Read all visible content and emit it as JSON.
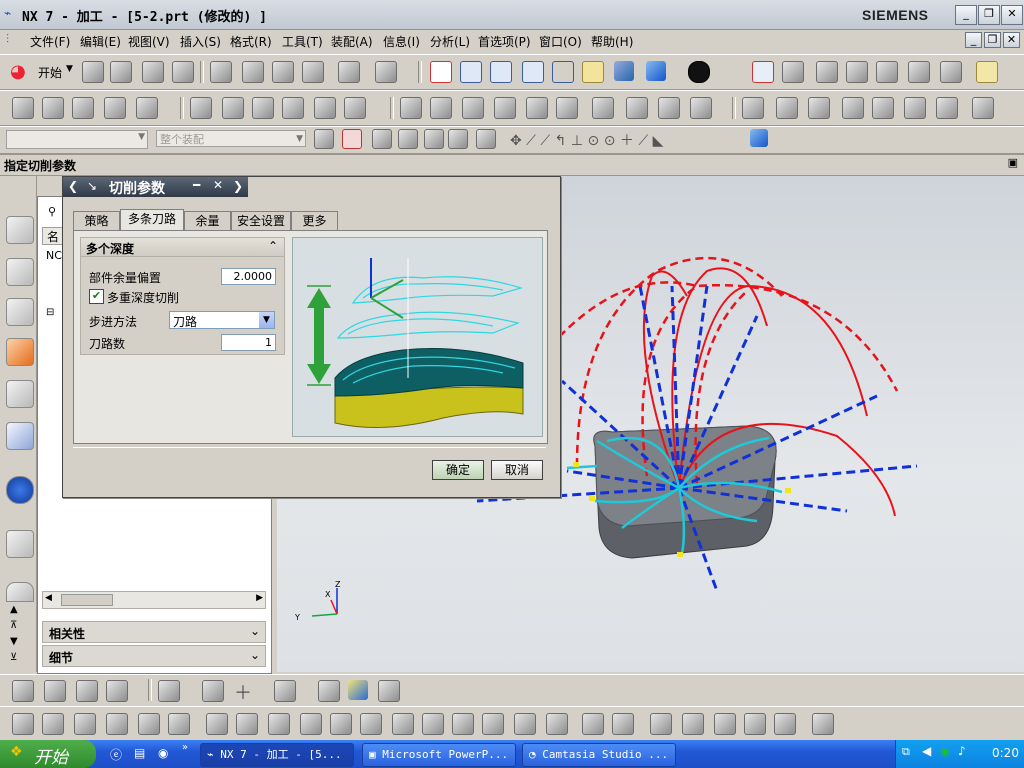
{
  "titlebar": {
    "title": "NX 7 - 加工 - [5-2.prt  (修改的) ]",
    "brand": "SIEMENS"
  },
  "menubar": {
    "items": [
      "文件(F)",
      "编辑(E)",
      "视图(V)",
      "插入(S)",
      "格式(R)",
      "工具(T)",
      "装配(A)",
      "信息(I)",
      "分析(L)",
      "首选项(P)",
      "窗口(O)",
      "帮助(H)"
    ]
  },
  "toolbar": {
    "start_label": "开始",
    "filter_placeholder": "整个装配"
  },
  "cue_line": {
    "text": "指定切削参数"
  },
  "navigator": {
    "col_name": "名",
    "row1": "NC"
  },
  "dialog": {
    "title": "切削参数",
    "tabs": [
      "策略",
      "多条刀路",
      "余量",
      "安全设置",
      "更多"
    ],
    "active_tab": "多条刀路",
    "group_title": "多个深度",
    "offset_label": "部件余量偏置",
    "offset_value": "2.0000",
    "multi_depth_label": "多重深度切削",
    "multi_depth_checked": true,
    "step_label": "步进方法",
    "step_value": "刀路",
    "count_label": "刀路数",
    "count_value": "1",
    "ok": "确定",
    "cancel": "取消"
  },
  "bottom_panels": {
    "related": "相关性",
    "details": "细节"
  },
  "axes": {
    "x": "X",
    "y": "Y",
    "z": "Z"
  },
  "taskbar": {
    "start": "开始",
    "tasks": [
      "NX 7 - 加工 - [5...",
      "Microsoft PowerP...",
      "Camtasia Studio ..."
    ],
    "clock": "0:20"
  },
  "colors": {
    "accent_green": "#2fa13b",
    "path_cyan": "#1ec9d8",
    "path_red": "#e8121a",
    "path_blue": "#1030d8"
  }
}
